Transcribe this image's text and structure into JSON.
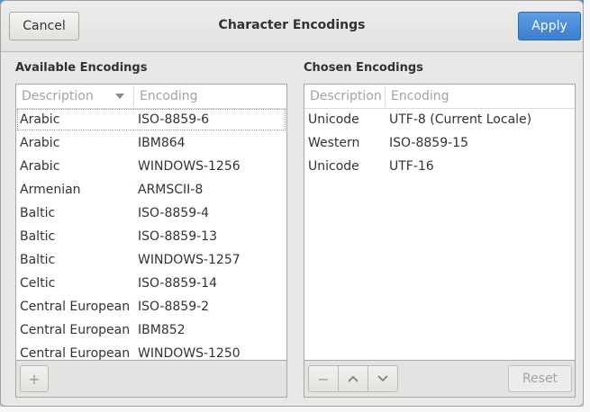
{
  "header": {
    "title": "Character Encodings",
    "cancel_label": "Cancel",
    "apply_label": "Apply"
  },
  "available": {
    "label": "Available Encodings",
    "col_description": "Description",
    "col_encoding": "Encoding",
    "rows": [
      {
        "description": "Arabic",
        "encoding": "ISO-8859-6"
      },
      {
        "description": "Arabic",
        "encoding": "IBM864"
      },
      {
        "description": "Arabic",
        "encoding": "WINDOWS-1256"
      },
      {
        "description": "Armenian",
        "encoding": "ARMSCII-8"
      },
      {
        "description": "Baltic",
        "encoding": "ISO-8859-4"
      },
      {
        "description": "Baltic",
        "encoding": "ISO-8859-13"
      },
      {
        "description": "Baltic",
        "encoding": "WINDOWS-1257"
      },
      {
        "description": "Celtic",
        "encoding": "ISO-8859-14"
      },
      {
        "description": "Central European",
        "encoding": "ISO-8859-2"
      },
      {
        "description": "Central European",
        "encoding": "IBM852"
      },
      {
        "description": "Central European",
        "encoding": "WINDOWS-1250"
      }
    ],
    "add_icon": "+"
  },
  "chosen": {
    "label": "Chosen Encodings",
    "col_description": "Description",
    "col_encoding": "Encoding",
    "rows": [
      {
        "description": "Unicode",
        "encoding": "UTF-8 (Current Locale)"
      },
      {
        "description": "Western",
        "encoding": "ISO-8859-15"
      },
      {
        "description": "Unicode",
        "encoding": "UTF-16"
      }
    ],
    "remove_icon": "−",
    "up_icon": "chevron-up-icon",
    "down_icon": "chevron-down-icon",
    "reset_label": "Reset"
  },
  "colors": {
    "accent": "#4a90d9",
    "apply_button": "#3a80d0"
  }
}
